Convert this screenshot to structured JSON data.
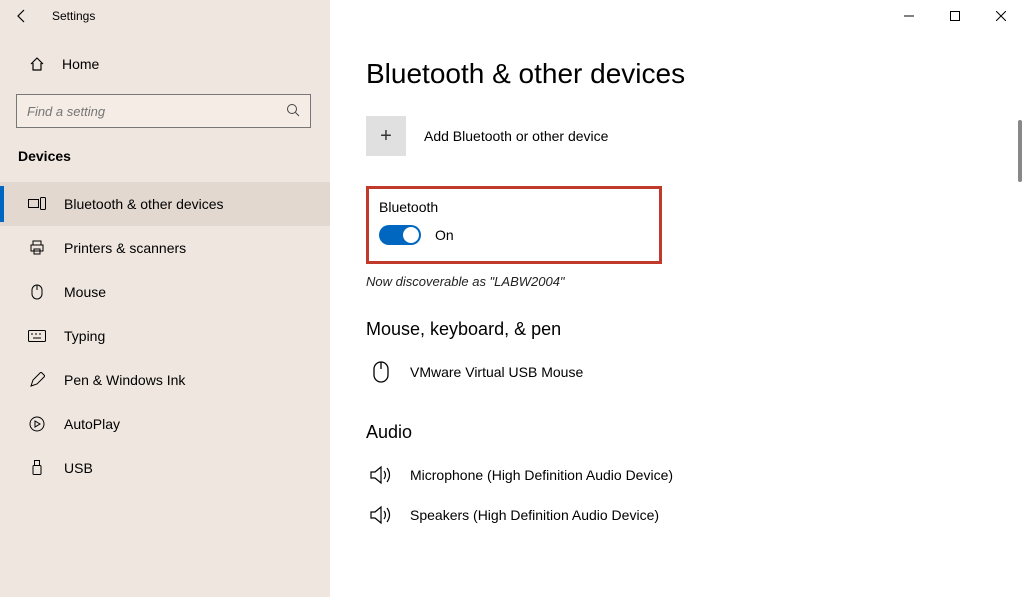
{
  "titlebar": {
    "app_title": "Settings"
  },
  "sidebar": {
    "home_label": "Home",
    "search_placeholder": "Find a setting",
    "section_label": "Devices",
    "items": [
      {
        "label": "Bluetooth & other devices"
      },
      {
        "label": "Printers & scanners"
      },
      {
        "label": "Mouse"
      },
      {
        "label": "Typing"
      },
      {
        "label": "Pen & Windows Ink"
      },
      {
        "label": "AutoPlay"
      },
      {
        "label": "USB"
      }
    ]
  },
  "content": {
    "heading": "Bluetooth & other devices",
    "add_device_label": "Add Bluetooth or other device",
    "bt_section_title": "Bluetooth",
    "bt_toggle_state": "On",
    "discoverable_text": "Now discoverable as \"LABW2004\"",
    "mkp_heading": "Mouse, keyboard, & pen",
    "mkp_devices": [
      {
        "label": "VMware Virtual USB Mouse"
      }
    ],
    "audio_heading": "Audio",
    "audio_devices": [
      {
        "label": "Microphone (High Definition Audio Device)"
      },
      {
        "label": "Speakers (High Definition Audio Device)"
      }
    ]
  }
}
